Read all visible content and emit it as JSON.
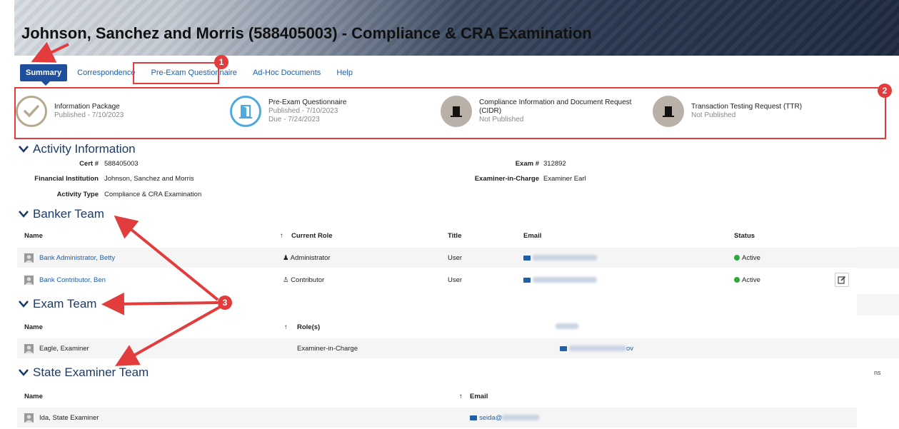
{
  "header": {
    "title": "Johnson, Sanchez and Morris (588405003) - Compliance & CRA Examination"
  },
  "nav": {
    "tabs": [
      "Summary",
      "Correspondence",
      "Pre-Exam Questionnaire",
      "Ad-Hoc Documents",
      "Help"
    ],
    "active_tab": "Summary"
  },
  "steps": [
    {
      "title": "Information Package",
      "sub": [
        "Published - 7/10/2023"
      ],
      "state": "done",
      "icon": "check-icon"
    },
    {
      "title": "Pre-Exam Questionnaire",
      "sub": [
        "Published - 7/10/2023",
        "Due - 7/24/2023"
      ],
      "state": "current",
      "icon": "open-door-icon"
    },
    {
      "title": "Compliance Information and Document Request",
      "title2": "(CIDR)",
      "sub": [
        "Not Published"
      ],
      "state": "pending",
      "icon": "closed-door-icon"
    },
    {
      "title": "Transaction Testing Request (TTR)",
      "sub": [
        "Not Published"
      ],
      "state": "pending",
      "icon": "closed-door-icon"
    }
  ],
  "activity": {
    "heading": "Activity Information",
    "cert_label": "Cert #",
    "cert_value": "588405003",
    "fi_label": "Financial Institution",
    "fi_value": "Johnson, Sanchez and Morris",
    "type_label": "Activity Type",
    "type_value": "Compliance & CRA Examination",
    "exam_label": "Exam #",
    "exam_value": "312892",
    "eic_label": "Examiner-in-Charge",
    "eic_value": "Examiner Earl"
  },
  "banker_team": {
    "heading": "Banker Team",
    "columns": [
      "Name",
      "Current Role",
      "Title",
      "Email",
      "Status"
    ],
    "rows": [
      {
        "name": "Bank Administrator, Betty",
        "role": "Administrator",
        "title": "User",
        "status": "Active"
      },
      {
        "name": "Bank Contributor, Ben",
        "role": "Contributor",
        "title": "User",
        "status": "Active"
      }
    ]
  },
  "exam_team": {
    "heading": "Exam Team",
    "columns": [
      "Name",
      "Role(s)"
    ],
    "rows": [
      {
        "name": "Eagle, Examiner",
        "role": "Examiner-in-Charge",
        "email_tail": "ov"
      }
    ]
  },
  "state_team": {
    "heading": "State Examiner Team",
    "columns": [
      "Name",
      "Email"
    ],
    "rows": [
      {
        "name": "Ida, State Examiner",
        "email_prefix": "seida@"
      }
    ]
  },
  "stray_text": "ns",
  "annotations": {
    "badges": [
      "1",
      "2",
      "3"
    ],
    "color": "#e23c3c"
  },
  "colors": {
    "brand_blue": "#1f4e9c",
    "link": "#1f5fa8",
    "heading": "#1c3b66",
    "active_green": "#2ea83a"
  }
}
